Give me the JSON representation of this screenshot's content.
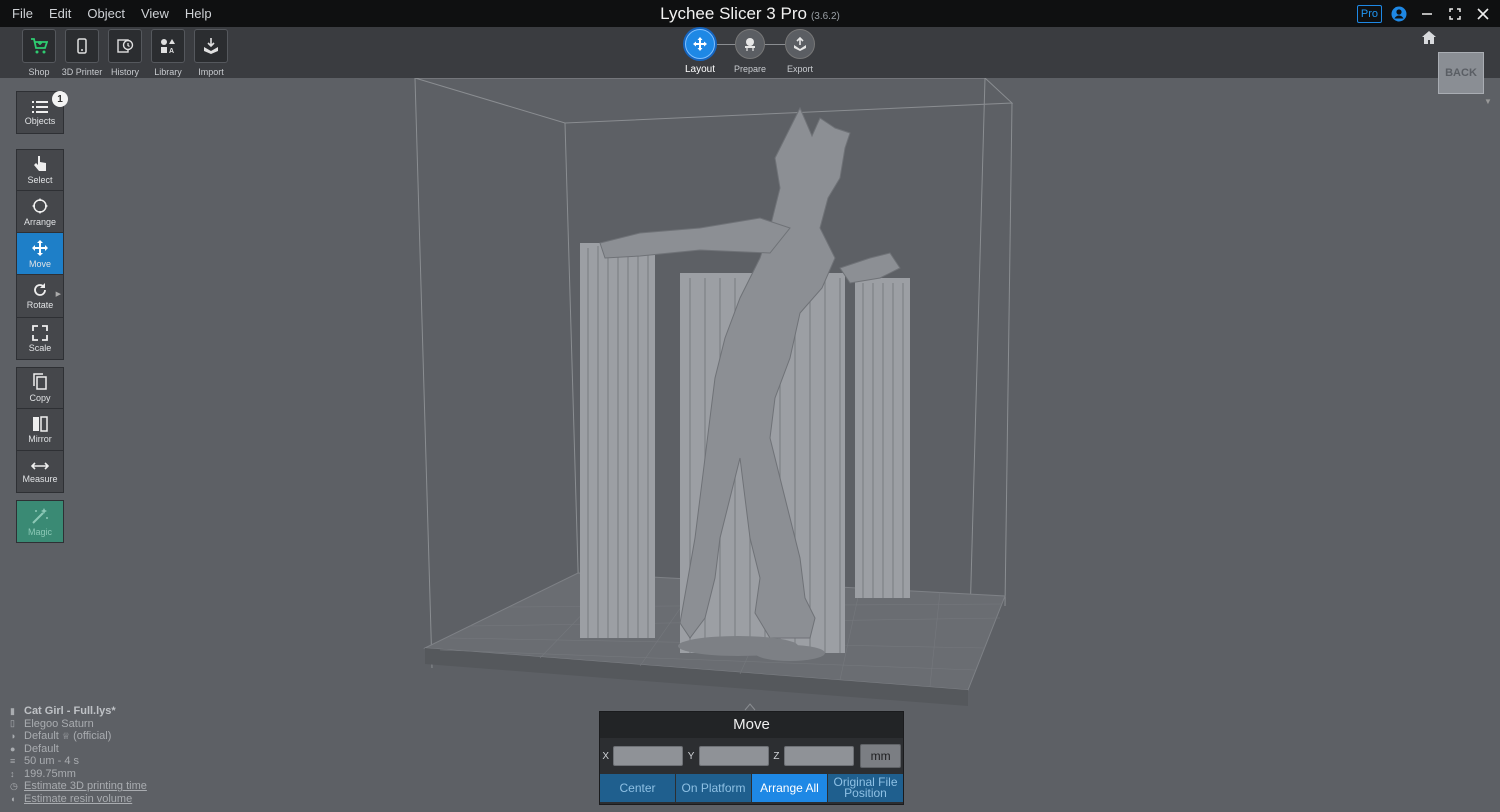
{
  "menu": [
    "File",
    "Edit",
    "Object",
    "View",
    "Help"
  ],
  "app": {
    "title": "Lychee Slicer 3 Pro",
    "version": "(3.6.2)"
  },
  "window": {
    "pro_badge": "Pro"
  },
  "toolbar": {
    "items": [
      {
        "label": "Shop",
        "icon": "cart-icon"
      },
      {
        "label": "3D Printer",
        "icon": "printer-icon"
      },
      {
        "label": "History",
        "icon": "history-icon"
      },
      {
        "label": "Library",
        "icon": "library-icon"
      },
      {
        "label": "Import",
        "icon": "import-icon"
      }
    ]
  },
  "steps": [
    {
      "label": "Layout",
      "active": true
    },
    {
      "label": "Prepare",
      "active": false
    },
    {
      "label": "Export",
      "active": false
    }
  ],
  "view_cube": {
    "label": "BACK"
  },
  "tools": {
    "objects": {
      "label": "Objects",
      "count": "1"
    },
    "select": "Select",
    "arrange": "Arrange",
    "move": "Move",
    "rotate": "Rotate",
    "scale": "Scale",
    "copy": "Copy",
    "mirror": "Mirror",
    "measure": "Measure",
    "magic": "Magic"
  },
  "info": {
    "file": "Cat Girl - Full.lys*",
    "printer": "Elegoo Saturn",
    "profile": "Default",
    "profile_suffix": "(official)",
    "resin": "Default",
    "layers": "50 um - 4 s",
    "height": "199.75mm",
    "estimate_time": "Estimate 3D printing time",
    "estimate_resin": "Estimate resin volume"
  },
  "move_panel": {
    "title": "Move",
    "x_label": "X",
    "y_label": "Y",
    "z_label": "Z",
    "x_value": "",
    "y_value": "",
    "z_value": "",
    "unit": "mm",
    "actions": [
      "Center",
      "On Platform",
      "Arrange All",
      "Original File Position"
    ]
  },
  "colors": {
    "accent": "#1e88e5",
    "magic": "#3a8a74"
  }
}
